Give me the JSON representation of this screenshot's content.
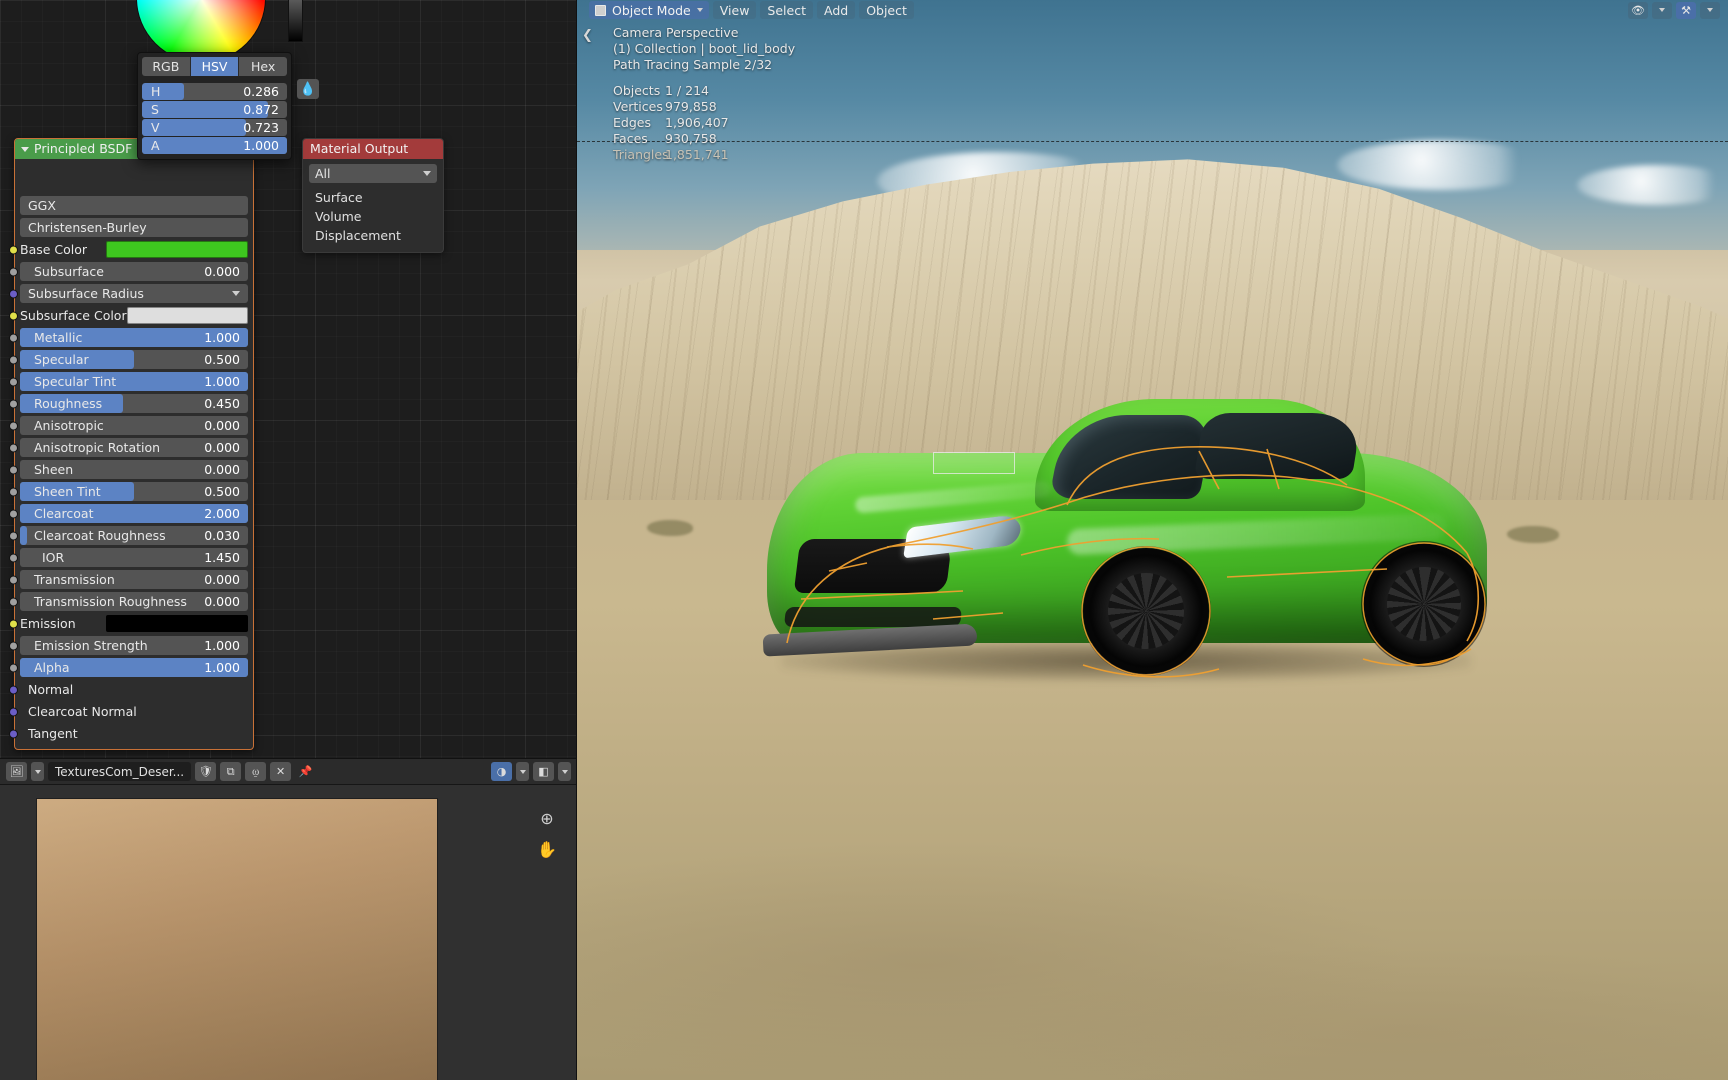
{
  "node_editor": {
    "bsdf_node": {
      "title": "Principled BSDF",
      "distribution": "GGX",
      "subsurface_method": "Christensen-Burley",
      "properties": [
        {
          "label": "Base Color",
          "type": "color",
          "value": "",
          "color": "#3ec71f",
          "socket": "yellow",
          "indent": 0
        },
        {
          "label": "Subsurface",
          "type": "slider",
          "value": "0.000",
          "fill": 0,
          "socket": "gray",
          "indent": 1
        },
        {
          "label": "Subsurface Radius",
          "type": "expand",
          "value": "",
          "fill": 0,
          "socket": "purple",
          "indent": 0
        },
        {
          "label": "Subsurface Color",
          "type": "color",
          "value": "",
          "color": "#dedede",
          "socket": "yellow",
          "indent": 0
        },
        {
          "label": "Metallic",
          "type": "slider",
          "value": "1.000",
          "fill": 100,
          "socket": "gray",
          "indent": 1
        },
        {
          "label": "Specular",
          "type": "slider",
          "value": "0.500",
          "fill": 50,
          "socket": "gray",
          "indent": 1
        },
        {
          "label": "Specular Tint",
          "type": "slider",
          "value": "1.000",
          "fill": 100,
          "socket": "gray",
          "indent": 1
        },
        {
          "label": "Roughness",
          "type": "slider",
          "value": "0.450",
          "fill": 45,
          "socket": "gray",
          "indent": 1
        },
        {
          "label": "Anisotropic",
          "type": "slider",
          "value": "0.000",
          "fill": 0,
          "socket": "gray",
          "indent": 1
        },
        {
          "label": "Anisotropic Rotation",
          "type": "slider",
          "value": "0.000",
          "fill": 0,
          "socket": "gray",
          "indent": 1
        },
        {
          "label": "Sheen",
          "type": "slider",
          "value": "0.000",
          "fill": 0,
          "socket": "gray",
          "indent": 1
        },
        {
          "label": "Sheen Tint",
          "type": "slider",
          "value": "0.500",
          "fill": 50,
          "socket": "gray",
          "indent": 1
        },
        {
          "label": "Clearcoat",
          "type": "slider",
          "value": "2.000",
          "fill": 100,
          "socket": "gray",
          "indent": 1
        },
        {
          "label": "Clearcoat Roughness",
          "type": "slider",
          "value": "0.030",
          "fill": 3,
          "socket": "gray",
          "indent": 1
        },
        {
          "label": "IOR",
          "type": "slider",
          "value": "1.450",
          "fill": 0,
          "socket": "gray",
          "indent": 2
        },
        {
          "label": "Transmission",
          "type": "slider",
          "value": "0.000",
          "fill": 0,
          "socket": "gray",
          "indent": 1
        },
        {
          "label": "Transmission Roughness",
          "type": "slider",
          "value": "0.000",
          "fill": 0,
          "socket": "gray",
          "indent": 1
        },
        {
          "label": "Emission",
          "type": "color",
          "value": "",
          "color": "#000000",
          "socket": "yellow",
          "indent": 0
        },
        {
          "label": "Emission Strength",
          "type": "slider",
          "value": "1.000",
          "fill": 0,
          "socket": "gray",
          "indent": 1
        },
        {
          "label": "Alpha",
          "type": "slider",
          "value": "1.000",
          "fill": 100,
          "socket": "gray",
          "indent": 1
        },
        {
          "label": "Normal",
          "type": "plain",
          "value": "",
          "fill": 0,
          "socket": "purple",
          "indent": 0
        },
        {
          "label": "Clearcoat Normal",
          "type": "plain",
          "value": "",
          "fill": 0,
          "socket": "purple",
          "indent": 0
        },
        {
          "label": "Tangent",
          "type": "plain",
          "value": "",
          "fill": 0,
          "socket": "purple",
          "indent": 0
        }
      ]
    },
    "material_output_node": {
      "title": "Material Output",
      "target_value": "All",
      "sockets": [
        "Surface",
        "Volume",
        "Displacement"
      ]
    },
    "color_picker": {
      "modes": [
        "RGB",
        "HSV",
        "Hex"
      ],
      "active_mode": "HSV",
      "channels": [
        {
          "label": "H",
          "value": "0.286",
          "fill": 29
        },
        {
          "label": "S",
          "value": "0.872",
          "fill": 87
        },
        {
          "label": "V",
          "value": "0.723",
          "fill": 72
        },
        {
          "label": "A",
          "value": "1.000",
          "fill": 100
        }
      ],
      "eyedropper_icon": "eyedropper-icon",
      "current_color": "#3ec71f"
    }
  },
  "image_editor": {
    "editor_type_icon": "image-editor-icon",
    "image_name": "TexturesCom_Deser...",
    "buttons": [
      {
        "name": "fake-user-shield-icon",
        "glyph": "⬟"
      },
      {
        "name": "new-image-copy-icon",
        "glyph": "⧉"
      },
      {
        "name": "image-bake-icon",
        "glyph": "⎙"
      },
      {
        "name": "unlink-image-icon",
        "glyph": "✕"
      },
      {
        "name": "pin-icon",
        "glyph": "📌"
      }
    ],
    "right_buttons": [
      {
        "name": "view-display-channels-icon",
        "glyph": "◑"
      },
      {
        "name": "image-display-mode-icon",
        "glyph": "◧"
      }
    ],
    "tools": [
      {
        "name": "zoom-tool-icon",
        "glyph": "⊕"
      },
      {
        "name": "pan-tool-icon",
        "glyph": "✋"
      }
    ]
  },
  "viewport": {
    "header": {
      "mode": "Object Mode",
      "menus": [
        "View",
        "Select",
        "Add",
        "Object"
      ],
      "right_icons": [
        {
          "name": "show-gizmo-icon",
          "glyph": "👁"
        },
        {
          "name": "show-overlays-icon",
          "glyph": "⚒"
        }
      ]
    },
    "overlay": {
      "view_name": "Camera Perspective",
      "collection": "(1) Collection | boot_lid_body",
      "render_progress": "Path Tracing Sample 2/32",
      "stats": [
        {
          "key": "Objects",
          "value": "1 / 214"
        },
        {
          "key": "Vertices",
          "value": "979,858"
        },
        {
          "key": "Edges",
          "value": "1,906,407"
        },
        {
          "key": "Faces",
          "value": "930,758"
        },
        {
          "key": "Triangles",
          "value": "1,851,741"
        }
      ]
    },
    "scene": {
      "object_description": "green sports car rendered in desert quarry environment",
      "selection_outline_color": "#f0a030"
    }
  }
}
